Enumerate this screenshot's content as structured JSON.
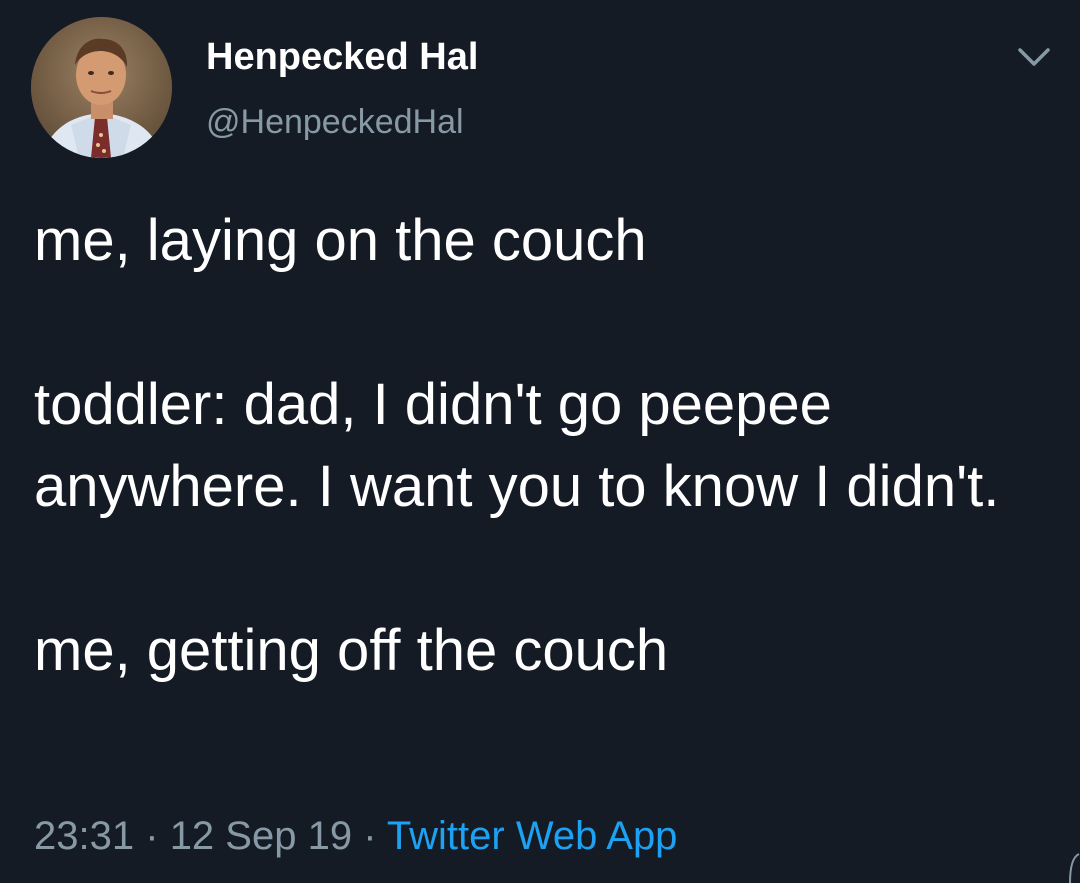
{
  "author": {
    "name": "Henpecked Hal",
    "handle": "@HenpeckedHal"
  },
  "menu_icon": "chevron-down-icon",
  "tweet_text": "me, laying on the couch\n\ntoddler: dad, I didn't go peepee anywhere. I want you to know I didn't.\n\nme, getting off the couch",
  "meta": {
    "time": "23:31",
    "separator": "·",
    "date": "12 Sep 19",
    "source": "Twitter Web App"
  },
  "colors": {
    "background": "#151b24",
    "text": "#ffffff",
    "secondary": "#8899a6",
    "link": "#1da1f2"
  }
}
